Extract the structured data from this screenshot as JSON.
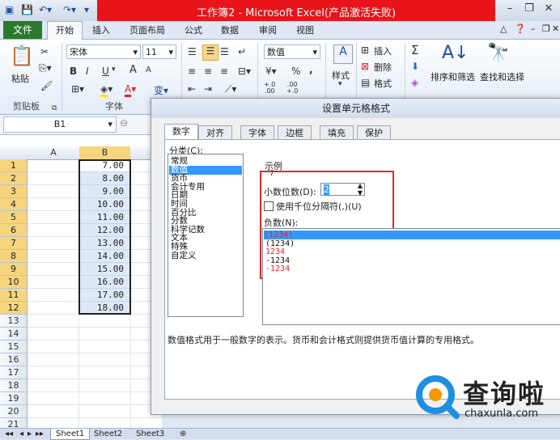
{
  "window": {
    "title": "工作簿2 - Microsoft Excel(产品激活失败)"
  },
  "ribbon_tabs": [
    "文件",
    "开始",
    "插入",
    "页面布局",
    "公式",
    "数据",
    "审阅",
    "视图"
  ],
  "clipboard": {
    "paste_label": "粘贴",
    "group_label": "剪贴板"
  },
  "font": {
    "name": "宋体",
    "size": "11",
    "group_label": "字体",
    "bold": "B",
    "italic": "I",
    "underline": "U",
    "grow": "A",
    "shrink": "A",
    "color_letter": "A",
    "wen": "变"
  },
  "number": {
    "format": "数值",
    "percent": "%",
    "comma": ",",
    "inc_decimal": "+.0\n.00",
    "dec_decimal": ".00\n+.0"
  },
  "styles": {
    "label": "样式"
  },
  "cells_group": {
    "insert": "插入",
    "delete": "删除",
    "format": "格式"
  },
  "editing": {
    "sort_filter": "排序和筛选",
    "find_select": "查找和选择",
    "sigma": "Σ"
  },
  "formula_bar": {
    "name_box": "B1"
  },
  "sheet": {
    "columns": [
      "A",
      "B"
    ],
    "row_numbers": [
      "1",
      "2",
      "3",
      "4",
      "5",
      "6",
      "7",
      "8",
      "9",
      "10",
      "11",
      "12",
      "13",
      "14",
      "15",
      "16",
      "17",
      "18",
      "19",
      "20",
      "21"
    ],
    "values": [
      "7.00",
      "8.00",
      "9.00",
      "10.00",
      "11.00",
      "12.00",
      "13.00",
      "14.00",
      "15.00",
      "16.00",
      "17.00",
      "18.00"
    ]
  },
  "sheet_tabs": [
    "Sheet1",
    "Sheet2",
    "Sheet3"
  ],
  "dialog": {
    "title": "设置单元格格式",
    "tabs": [
      "数字",
      "对齐",
      "字体",
      "边框",
      "填充",
      "保护"
    ],
    "category_label": "分类(C):",
    "categories": [
      "常规",
      "数值",
      "货币",
      "会计专用",
      "日期",
      "时间",
      "百分比",
      "分数",
      "科学记数",
      "文本",
      "特殊",
      "自定义"
    ],
    "selected_category": "数值",
    "sample_label": "示例",
    "sample_value": "7",
    "decimal_label": "小数位数(D):",
    "decimal_value": "2",
    "thousands_label": "使用千位分隔符(,)(U)",
    "negative_label": "负数(N):",
    "negative_options": [
      {
        "text": "(1234)",
        "color": "#e0262d"
      },
      {
        "text": "(1234)",
        "color": "#111111"
      },
      {
        "text": "1234",
        "color": "#e0262d"
      },
      {
        "text": "-1234",
        "color": "#111111"
      },
      {
        "text": "-1234",
        "color": "#e0262d"
      }
    ],
    "description": "数值格式用于一般数字的表示。货币和会计格式则提供货币值计算的专用格式。"
  },
  "watermark": {
    "text": "查询啦",
    "url": "chaxunla.com"
  },
  "colors": {
    "title_red": "#e8141a",
    "file_tab": "#2b7a2b",
    "selection": "#3399ff",
    "highlight_box": "#e0262d",
    "watermark_blue": "#1e8fe0"
  }
}
